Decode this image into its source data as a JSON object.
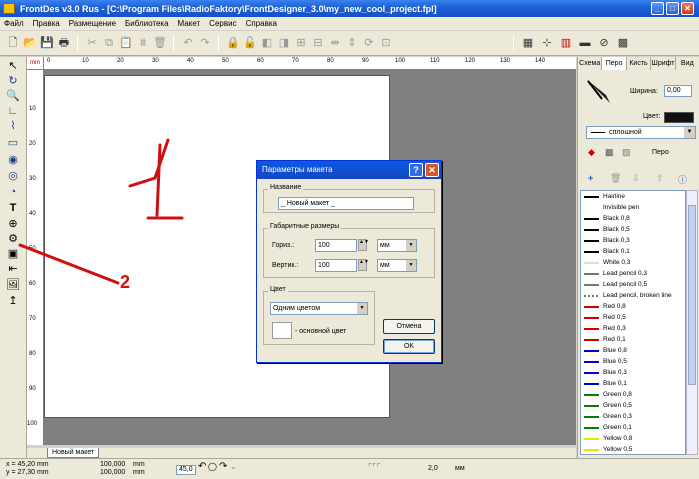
{
  "window": {
    "title": "FrontDes v3.0 Rus - [C:\\Program Files\\RadioFaktory\\FrontDesigner_3.0\\my_new_cool_project.fpl]"
  },
  "menu": [
    "Файл",
    "Правка",
    "Размещение",
    "Библиотека",
    "Макет",
    "Сервис",
    "Справка"
  ],
  "rulers": {
    "unit": "mm",
    "h_ticks": [
      "0",
      "10",
      "20",
      "30",
      "40",
      "50",
      "60",
      "70",
      "80",
      "90",
      "100",
      "110",
      "120",
      "130",
      "140"
    ],
    "v_ticks": [
      "10",
      "20",
      "30",
      "40",
      "50",
      "60",
      "70",
      "80",
      "90",
      "100"
    ]
  },
  "tabs": {
    "active": "Новый макет"
  },
  "status": {
    "x": "x = 45,20 mm",
    "y": "y = 27,30 mm",
    "width": "100,000",
    "height": "100,000",
    "unit1": "mm",
    "unit2": "mm",
    "angle": "45,0",
    "line_width": "2,0",
    "line_unit": "мм"
  },
  "right_panel": {
    "tabs": [
      "Схема",
      "Перо",
      "Кисть",
      "Шрифт",
      "Вид"
    ],
    "width_label": "Ширина:",
    "width_value": "0,00",
    "color_label": "Цвет:",
    "line_style": "сплошной",
    "pen_label": "Перо",
    "pens": [
      {
        "name": "Hairline",
        "color": "#000000"
      },
      {
        "name": "Invisible pen",
        "color": "#ffffff"
      },
      {
        "name": "Black 0,8",
        "color": "#000000"
      },
      {
        "name": "Black 0,5",
        "color": "#000000"
      },
      {
        "name": "Black 0,3",
        "color": "#000000"
      },
      {
        "name": "Black 0,1",
        "color": "#000000"
      },
      {
        "name": "White 0,3",
        "color": "#dddddd"
      },
      {
        "name": "Lead pencil 0,3",
        "color": "#777777"
      },
      {
        "name": "Lead pencil 0,5",
        "color": "#777777"
      },
      {
        "name": "Lead pencil, broken line",
        "color": "#777777"
      },
      {
        "name": "Red 0,8",
        "color": "#d00000"
      },
      {
        "name": "Red 0,5",
        "color": "#d00000"
      },
      {
        "name": "Red 0,3",
        "color": "#d00000"
      },
      {
        "name": "Red 0,1",
        "color": "#d00000"
      },
      {
        "name": "Blue 0,8",
        "color": "#0000d0"
      },
      {
        "name": "Blue 0,5",
        "color": "#0000d0"
      },
      {
        "name": "Blue 0,3",
        "color": "#0000d0"
      },
      {
        "name": "Blue 0,1",
        "color": "#0000d0"
      },
      {
        "name": "Green 0,8",
        "color": "#008000"
      },
      {
        "name": "Green 0,5",
        "color": "#008000"
      },
      {
        "name": "Green 0,3",
        "color": "#008000"
      },
      {
        "name": "Green 0,1",
        "color": "#008000"
      },
      {
        "name": "Yellow 0,8",
        "color": "#e6e600"
      },
      {
        "name": "Yellow 0,5",
        "color": "#e6e600"
      }
    ]
  },
  "dialog": {
    "title": "Параметры макета",
    "name_group": "Название",
    "name_value": "_ Новый макет _",
    "size_group": "Габаритные размеры",
    "horiz_label": "Гориз.:",
    "horiz_value": "100",
    "horiz_unit": "мм",
    "vert_label": "Вертик.:",
    "vert_value": "100",
    "vert_unit": "мм",
    "color_group": "Цвет",
    "color_mode": "Одним цветом",
    "main_color_label": "- основной цвет",
    "cancel": "Отмена",
    "ok": "OK"
  },
  "annotations": {
    "label_1": "1",
    "label_2": "2",
    "color": "#d01010"
  }
}
